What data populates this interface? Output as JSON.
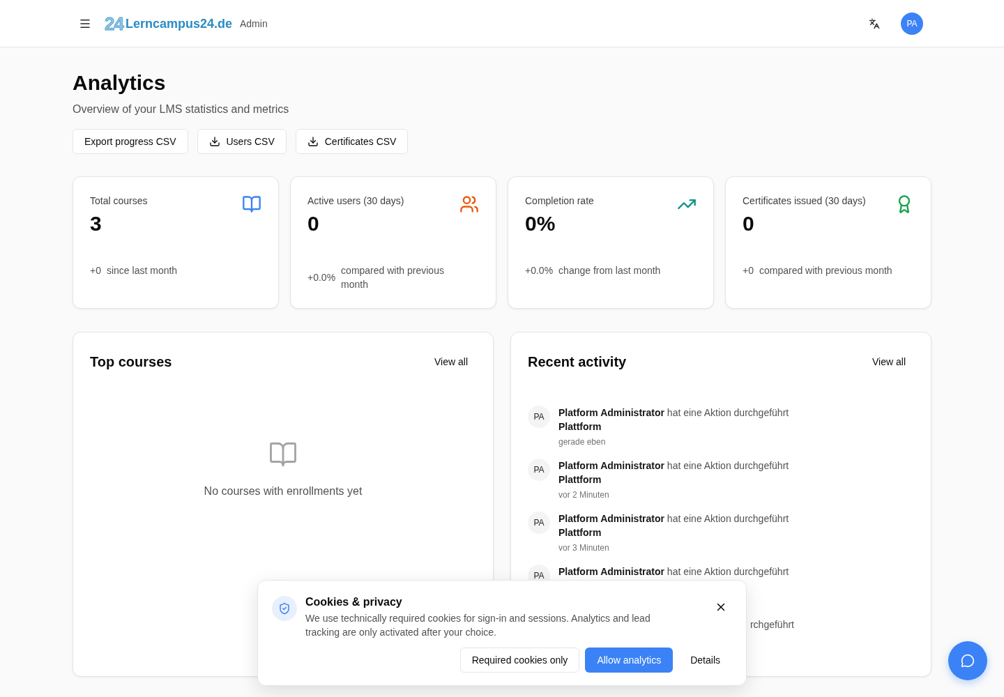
{
  "header": {
    "logo": {
      "mark": "24",
      "name": "Lerncampus24.de",
      "suffix": "Admin"
    },
    "avatar": "PA"
  },
  "page": {
    "title": "Analytics",
    "subtitle": "Overview of your LMS statistics and metrics"
  },
  "exports": [
    {
      "label": "Export progress CSV",
      "kind": "plain"
    },
    {
      "label": "Users CSV",
      "kind": "download"
    },
    {
      "label": "Certificates CSV",
      "kind": "download"
    }
  ],
  "stats": [
    {
      "label": "Total courses",
      "value": "3",
      "change": "+0",
      "description": "since last month",
      "color": "#3b82f6"
    },
    {
      "label": "Active users (30 days)",
      "value": "0",
      "change": "+0.0%",
      "description": "compared with previous month",
      "color": "#ea580c"
    },
    {
      "label": "Completion rate",
      "value": "0%",
      "change": "+0.0%",
      "description": "change from last month",
      "color": "#0d9488"
    },
    {
      "label": "Certificates issued (30 days)",
      "value": "0",
      "change": "+0",
      "description": "compared with previous month",
      "color": "#16a34a"
    }
  ],
  "top_courses": {
    "title": "Top courses",
    "action": "View all",
    "empty_message": "No courses with enrollments yet"
  },
  "recent_activity": {
    "title": "Recent activity",
    "action": "View all",
    "items": [
      {
        "kind": "entry",
        "avatar": "PA",
        "text": "**Platform Administrator** hat eine Aktion durchgeführt",
        "target": "Plattform",
        "time": "gerade eben"
      },
      {
        "kind": "entry",
        "avatar": "PA",
        "text": "**Platform Administrator** hat eine Aktion durchgeführt",
        "target": "Plattform",
        "time": "vor 2 Minuten"
      },
      {
        "kind": "entry",
        "avatar": "PA",
        "text": "**Platform Administrator** hat eine Aktion durchgeführt",
        "target": "Plattform",
        "time": "vor 3 Minuten"
      },
      {
        "kind": "entry",
        "avatar": "PA",
        "text": "**Platform Administrator** hat eine Aktion durchgeführt"
      },
      {
        "kind": "tail",
        "text": "rchgeführt"
      }
    ]
  },
  "cookie_banner": {
    "title": "Cookies & privacy",
    "text": "We use technically required cookies for sign-in and sessions. Analytics and lead tracking are only activated after your choice.",
    "actions": [
      {
        "label": "Required cookies only",
        "kind": "outline"
      },
      {
        "label": "Allow analytics",
        "kind": "primary"
      },
      {
        "label": "Details",
        "kind": "ghost"
      }
    ]
  }
}
